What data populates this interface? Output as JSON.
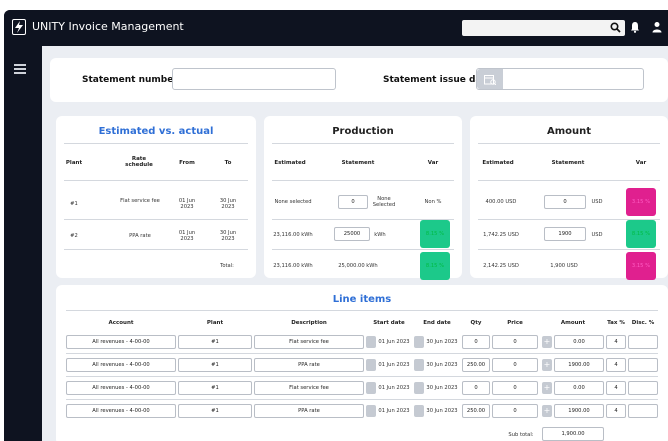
{
  "app": {
    "title": "UNITY Invoice Management"
  },
  "statement": {
    "number_label": "Statement number:",
    "number_value": "",
    "date_label": "Statement issue date:",
    "date_value": ""
  },
  "estimated": {
    "title": "Estimated vs. actual",
    "headers": [
      "Plant",
      "Rate schedule",
      "From",
      "To"
    ],
    "rows": [
      {
        "plant": "#1",
        "rate": "Flat service fee",
        "from": "01 Jun 2023",
        "to": "30 Jun 2023"
      },
      {
        "plant": "#2",
        "rate": "PPA rate",
        "from": "01 Jun 2023",
        "to": "30 Jun 2023"
      }
    ],
    "total_label": "Total:"
  },
  "production": {
    "title": "Production",
    "headers": [
      "Estimated",
      "Statement",
      "Var"
    ],
    "rows": [
      {
        "estimated": "None selected",
        "statement": "0",
        "unit": "None Selected",
        "var": "Non %",
        "var_color": "none"
      },
      {
        "estimated": "23,116.00 kWh",
        "statement": "25000",
        "unit": "kWh",
        "var": "8.15 %",
        "var_color": "green"
      }
    ],
    "total": {
      "estimated": "23,116.00 kWh",
      "statement": "25,000.00 kWh",
      "var": "8.15 %",
      "var_color": "green"
    }
  },
  "amount": {
    "title": "Amount",
    "headers": [
      "Estimated",
      "Statement",
      "Var"
    ],
    "rows": [
      {
        "estimated": "400.00 USD",
        "statement": "0",
        "unit": "USD",
        "var": "3.15 %",
        "var_color": "pink"
      },
      {
        "estimated": "1,742.25 USD",
        "statement": "1900",
        "unit": "USD",
        "var": "8.15 %",
        "var_color": "green"
      }
    ],
    "total": {
      "estimated": "2,142.25 USD",
      "statement": "1,900 USD",
      "var": "3.15 %",
      "var_color": "pink"
    }
  },
  "line_items": {
    "title": "Line items",
    "headers": [
      "Account",
      "Plant",
      "Description",
      "Start date",
      "End date",
      "Qty",
      "Price",
      "Amount",
      "Tax %",
      "Disc. %"
    ],
    "rows": [
      {
        "account": "All revenues - 4-00-00",
        "plant": "#1",
        "description": "Flat service fee",
        "start": "01 Jun 2023",
        "end": "30 Jun 2023",
        "qty": "0",
        "price": "0",
        "amount": "0.00",
        "tax": "4",
        "disc": ""
      },
      {
        "account": "All revenues - 4-00-00",
        "plant": "#1",
        "description": "PPA rate",
        "start": "01 Jun 2023",
        "end": "30 Jun 2023",
        "qty": "250.00",
        "price": "0",
        "amount": "1900.00",
        "tax": "4",
        "disc": ""
      },
      {
        "account": "All revenues - 4-00-00",
        "plant": "#1",
        "description": "Flat service fee",
        "start": "01 Jun 2023",
        "end": "30 Jun 2023",
        "qty": "0",
        "price": "0",
        "amount": "0.00",
        "tax": "4",
        "disc": ""
      },
      {
        "account": "All revenues - 4-00-00",
        "plant": "#1",
        "description": "PPA rate",
        "start": "01 Jun 2023",
        "end": "30 Jun 2023",
        "qty": "250.00",
        "price": "0",
        "amount": "1900.00",
        "tax": "4",
        "disc": ""
      }
    ],
    "subtotal_label": "Sub total:",
    "subtotal_value": "1,900.00"
  },
  "colors": {
    "bg": "#0e1320",
    "accent": "#2f6fd6",
    "green": "#1cc98a",
    "pink": "#e0208f"
  }
}
